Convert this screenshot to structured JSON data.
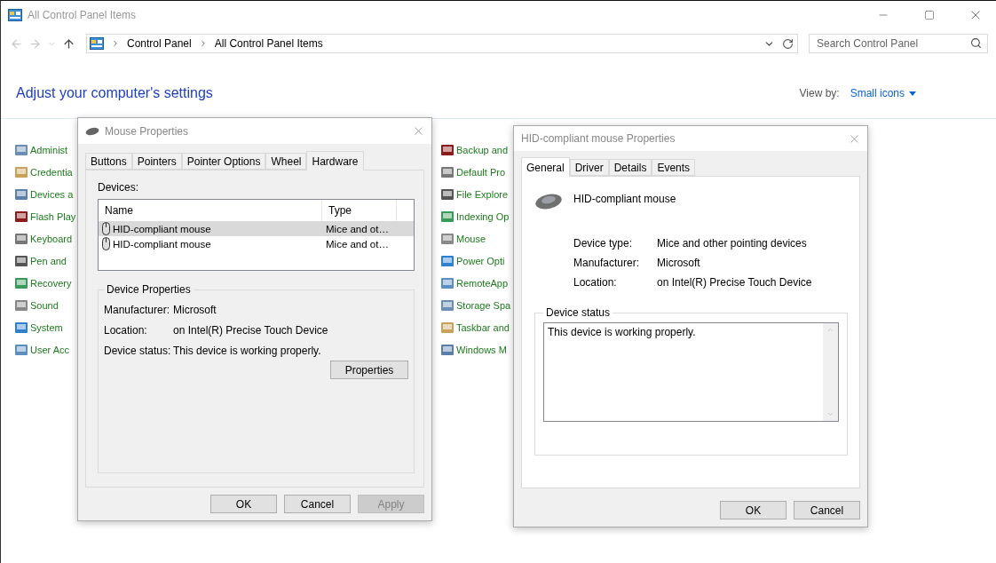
{
  "window": {
    "title": "All Control Panel Items"
  },
  "address_bar": {
    "path": [
      "Control Panel",
      "All Control Panel Items"
    ]
  },
  "search": {
    "placeholder": "Search Control Panel"
  },
  "heading": "Adjust your computer's settings",
  "view_by": {
    "label": "View by:",
    "value": "Small icons"
  },
  "item_columns": [
    [
      "Administ",
      "Credentia",
      "Devices a",
      "Flash Play",
      "Keyboard",
      "Pen and",
      "Recovery",
      "Sound",
      "System",
      "User Acc"
    ],
    [
      "Backup and",
      "Default Pro",
      "File Explore",
      "Indexing Op",
      "Mouse",
      "Power Opti",
      "RemoteApp",
      "Storage Spa",
      "Taskbar and",
      "Windows M"
    ]
  ],
  "mouse_properties": {
    "title": "Mouse Properties",
    "tabs": [
      {
        "label": "Buttons",
        "selected": false
      },
      {
        "label": "Pointers",
        "selected": false
      },
      {
        "label": "Pointer Options",
        "selected": false
      },
      {
        "label": "Wheel",
        "selected": false
      },
      {
        "label": "Hardware",
        "selected": true
      }
    ],
    "devices_label": "Devices:",
    "columns": [
      "Name",
      "Type"
    ],
    "devices": [
      {
        "name": "HID-compliant mouse",
        "type": "Mice and ot…",
        "selected": true
      },
      {
        "name": "HID-compliant mouse",
        "type": "Mice and ot…",
        "selected": false
      }
    ],
    "group": {
      "title": "Device Properties",
      "fields": [
        {
          "label": "Manufacturer:",
          "value": "Microsoft"
        },
        {
          "label": "Location:",
          "value": "on Intel(R) Precise Touch Device"
        },
        {
          "label": "Device status:",
          "value": "This device is working properly."
        }
      ]
    },
    "properties_button": "Properties",
    "buttons": [
      {
        "label": "OK",
        "disabled": false
      },
      {
        "label": "Cancel",
        "disabled": false
      },
      {
        "label": "Apply",
        "disabled": true
      }
    ]
  },
  "device_properties": {
    "title": "HID-compliant mouse Properties",
    "tabs": [
      {
        "label": "General",
        "selected": true
      },
      {
        "label": "Driver",
        "selected": false
      },
      {
        "label": "Details",
        "selected": false
      },
      {
        "label": "Events",
        "selected": false
      }
    ],
    "device_name": "HID-compliant mouse",
    "fields": [
      {
        "label": "Device type:",
        "value": "Mice and other pointing devices"
      },
      {
        "label": "Manufacturer:",
        "value": "Microsoft"
      },
      {
        "label": "Location:",
        "value": "on Intel(R) Precise Touch Device"
      }
    ],
    "status_group": {
      "title": "Device status",
      "text": "This device is working properly."
    },
    "buttons": [
      {
        "label": "OK",
        "disabled": false
      },
      {
        "label": "Cancel",
        "disabled": false
      }
    ]
  }
}
